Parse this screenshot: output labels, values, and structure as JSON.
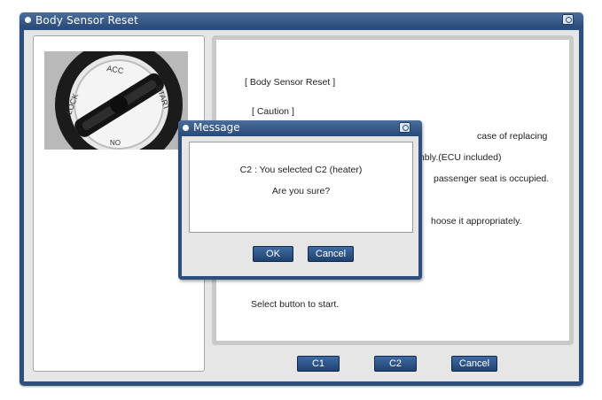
{
  "window": {
    "title": "Body Sensor Reset"
  },
  "main": {
    "heading": "[ Body Sensor Reset ]",
    "caution": "[ Caution ]",
    "lines": [
      "case of replacing",
      "mbly.(ECU included)",
      "passenger seat is occupied.",
      "hoose it appropriately."
    ],
    "instruction": "Select button to start."
  },
  "buttons": {
    "c1": "C1",
    "c2": "C2",
    "cancel": "Cancel"
  },
  "ignition_labels": [
    "LOCK",
    "ACC",
    "START",
    "ON"
  ],
  "dialog": {
    "title": "Message",
    "line1": "C2 : You selected C2 (heater)",
    "line2": "Are you sure?",
    "ok": "OK",
    "cancel": "Cancel"
  }
}
